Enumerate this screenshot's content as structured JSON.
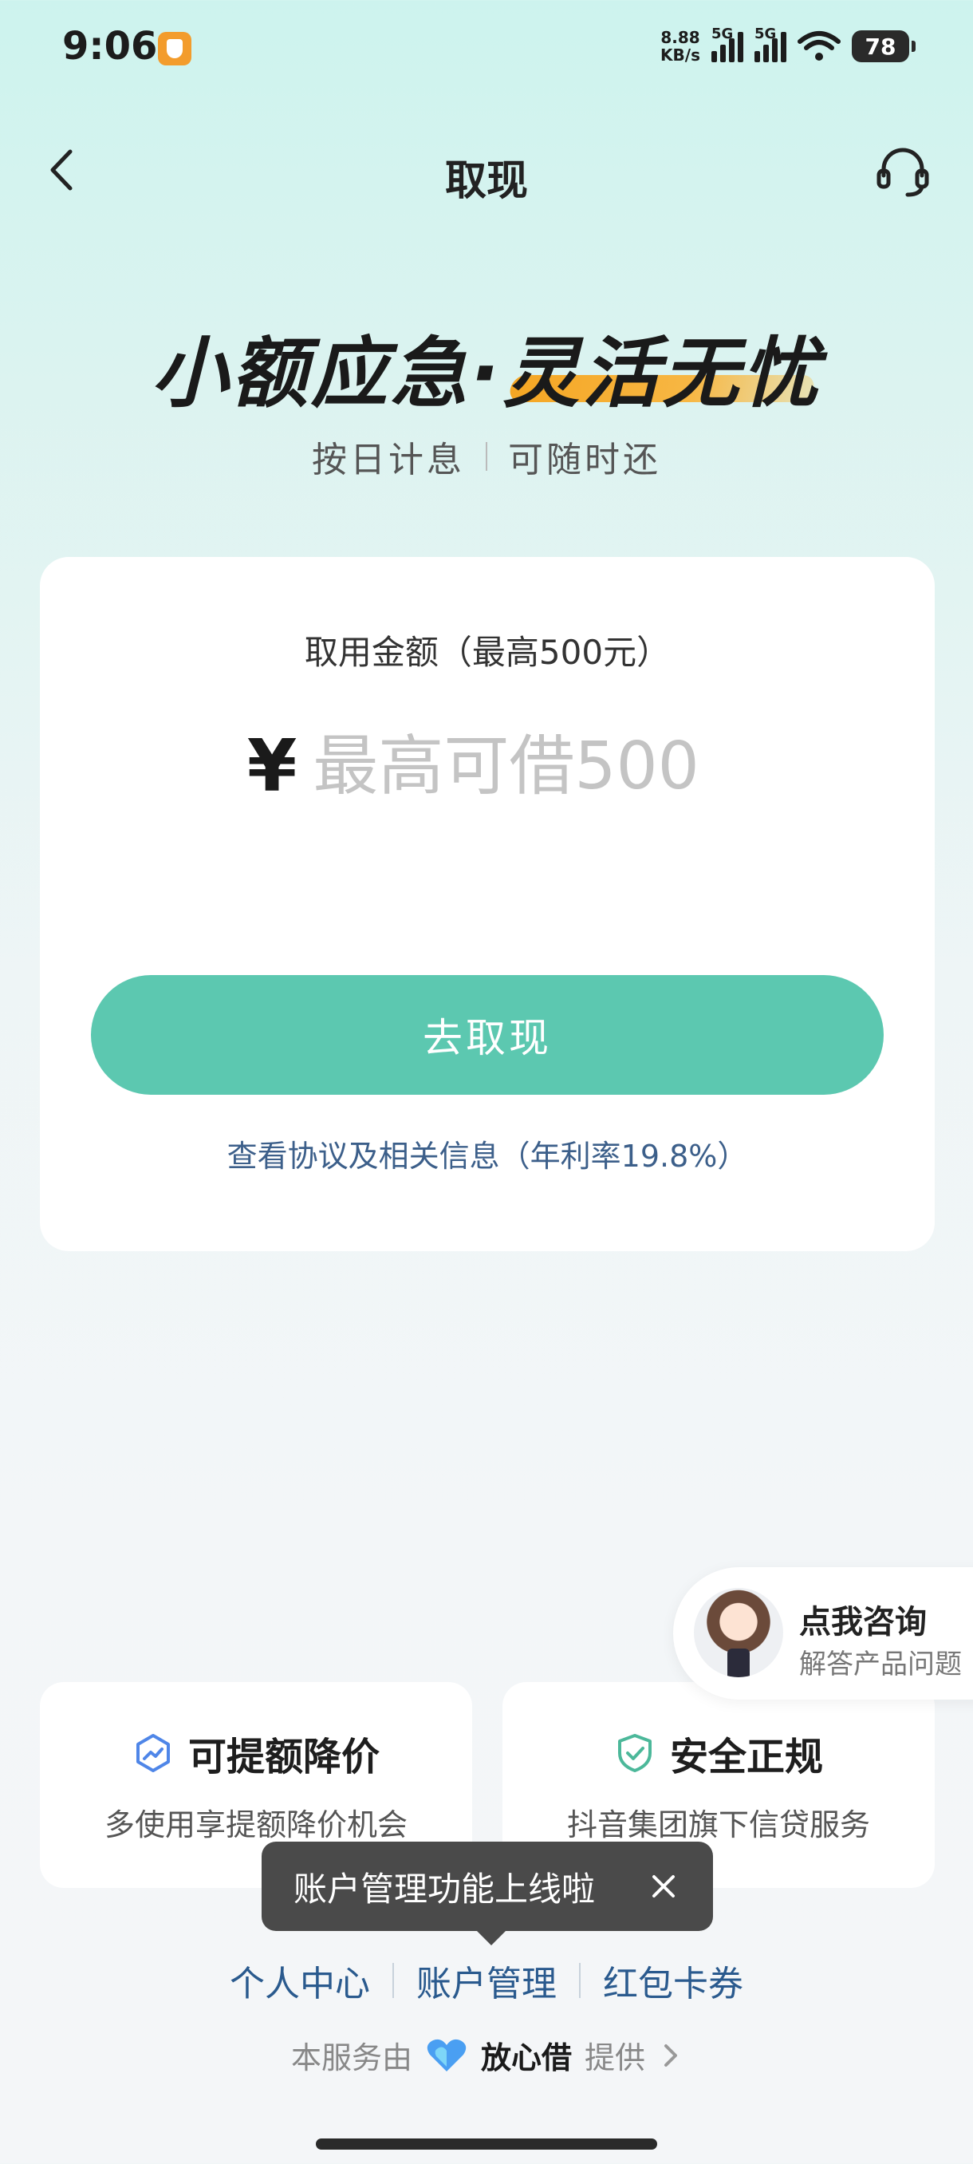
{
  "status_bar": {
    "time": "9:06",
    "net_speed_value": "8.88",
    "net_speed_unit": "KB/s",
    "signal1_label": "5G",
    "signal2_label": "5G",
    "battery": "78"
  },
  "nav": {
    "title": "取现",
    "back_icon": "chevron-left-icon",
    "support_icon": "headset-icon"
  },
  "hero": {
    "title": "小额应急·灵活无忧",
    "sub_left": "按日计息",
    "sub_right": "可随时还",
    "accent_color": "#f5a623"
  },
  "card": {
    "amount_label": "取用金额（最高500元）",
    "currency_symbol": "¥",
    "amount_value": "",
    "amount_placeholder": "最高可借500",
    "withdraw_button": "去取现",
    "agreement_link": "查看协议及相关信息（年利率19.8%）",
    "button_color": "#5cc8b0"
  },
  "consult": {
    "title": "点我咨询",
    "subtitle": "解答产品问题"
  },
  "features": [
    {
      "icon": "trend-up-hexagon-icon",
      "title": "可提额降价",
      "desc": "多使用享提额降价机会"
    },
    {
      "icon": "shield-check-icon",
      "title": "安全正规",
      "desc": "抖音集团旗下信贷服务"
    }
  ],
  "tooltip": {
    "text": "账户管理功能上线啦",
    "close_icon": "close-icon"
  },
  "bottom_links": [
    "个人中心",
    "账户管理",
    "红包卡券"
  ],
  "provider": {
    "prefix": "本服务由",
    "name": "放心借",
    "suffix": "提供"
  }
}
